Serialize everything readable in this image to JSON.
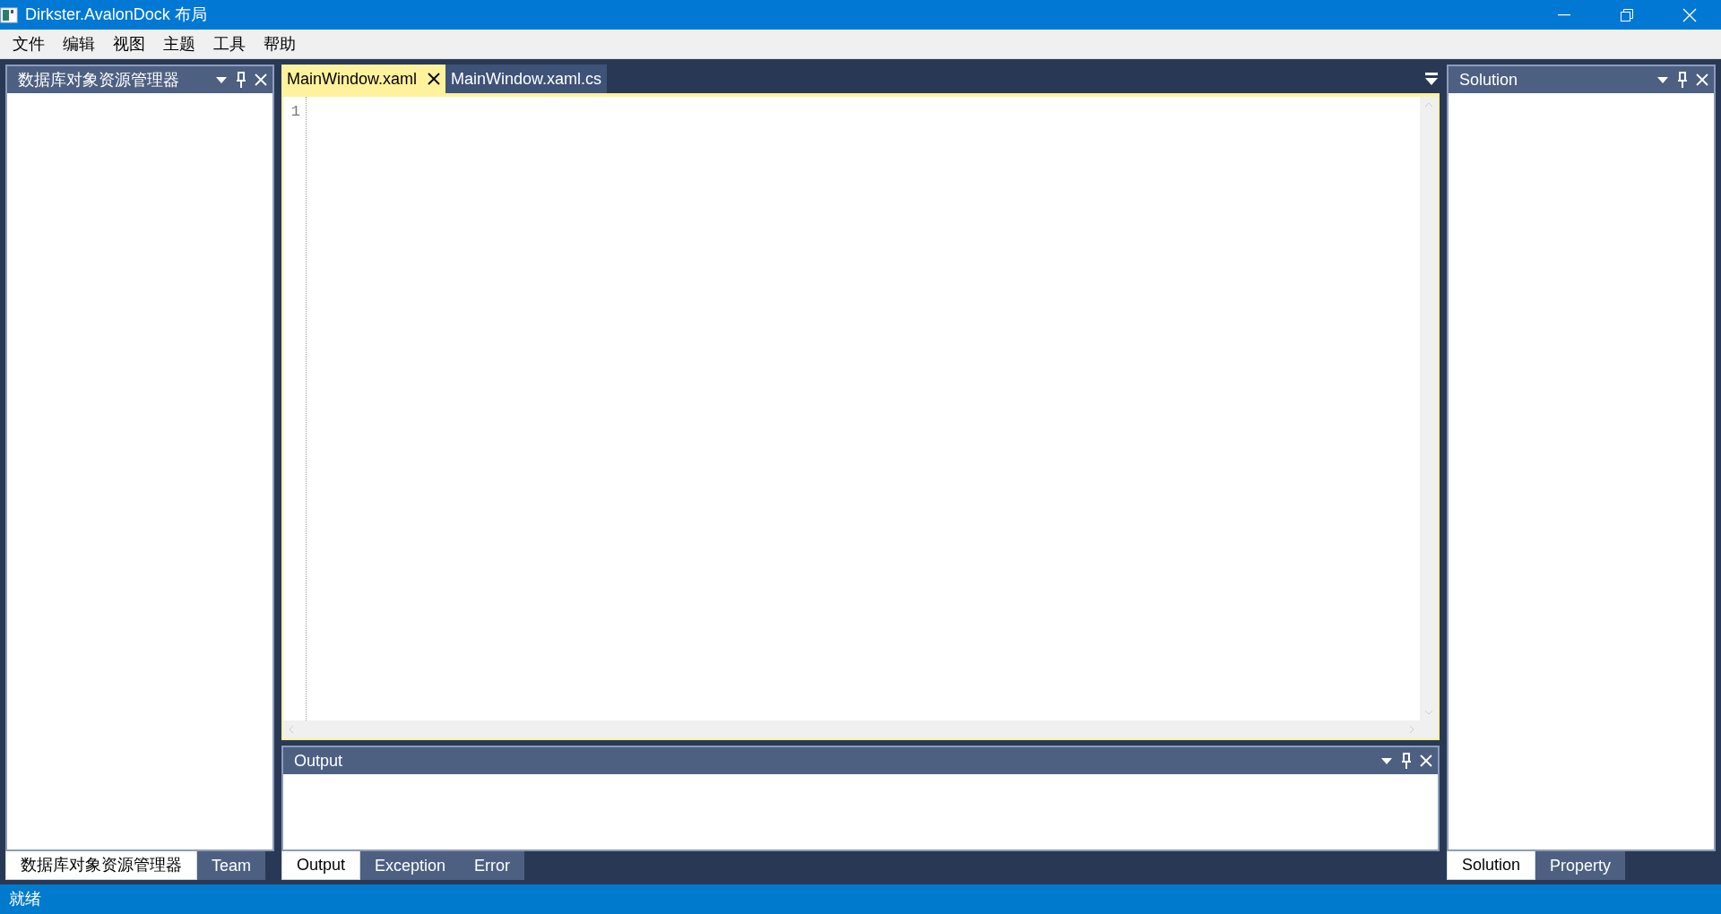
{
  "window": {
    "title": "Dirkster.AvalonDock 布局"
  },
  "menu": [
    "文件",
    "编辑",
    "视图",
    "主题",
    "工具",
    "帮助"
  ],
  "left_pane": {
    "title": "数据库对象资源管理器",
    "tabs": [
      {
        "label": "数据库对象资源管理器",
        "selected": true
      },
      {
        "label": "Team",
        "selected": false
      }
    ]
  },
  "documents": {
    "tabs": [
      {
        "label": "MainWindow.xaml",
        "selected": true
      },
      {
        "label": "MainWindow.xaml.cs",
        "selected": false
      }
    ],
    "line_numbers": [
      "1"
    ]
  },
  "output_pane": {
    "title": "Output",
    "tabs": [
      {
        "label": "Output",
        "selected": true
      },
      {
        "label": "Exception",
        "selected": false
      },
      {
        "label": "Error",
        "selected": false
      }
    ]
  },
  "right_pane": {
    "title": "Solution",
    "tabs": [
      {
        "label": "Solution",
        "selected": true
      },
      {
        "label": "Property",
        "selected": false
      }
    ]
  },
  "status_bar": "就绪"
}
